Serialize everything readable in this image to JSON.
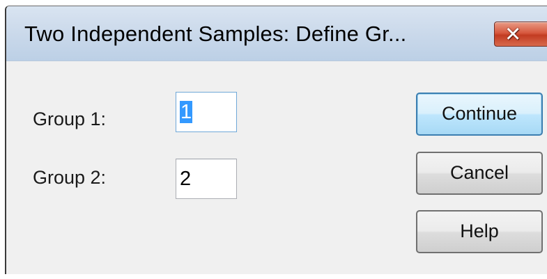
{
  "window": {
    "title": "Two Independent Samples: Define Gr...",
    "close_glyph": "✕"
  },
  "form": {
    "group1_label": "Group 1:",
    "group1_value": "1",
    "group2_label": "Group 2:",
    "group2_value": "2"
  },
  "buttons": {
    "continue_label": "Continue",
    "cancel_label": "Cancel",
    "help_label": "Help"
  },
  "colors": {
    "titlebar": "#c9d8ea",
    "close_button": "#c23c22",
    "selection": "#3399ff",
    "default_button_border": "#3c7fb1"
  }
}
